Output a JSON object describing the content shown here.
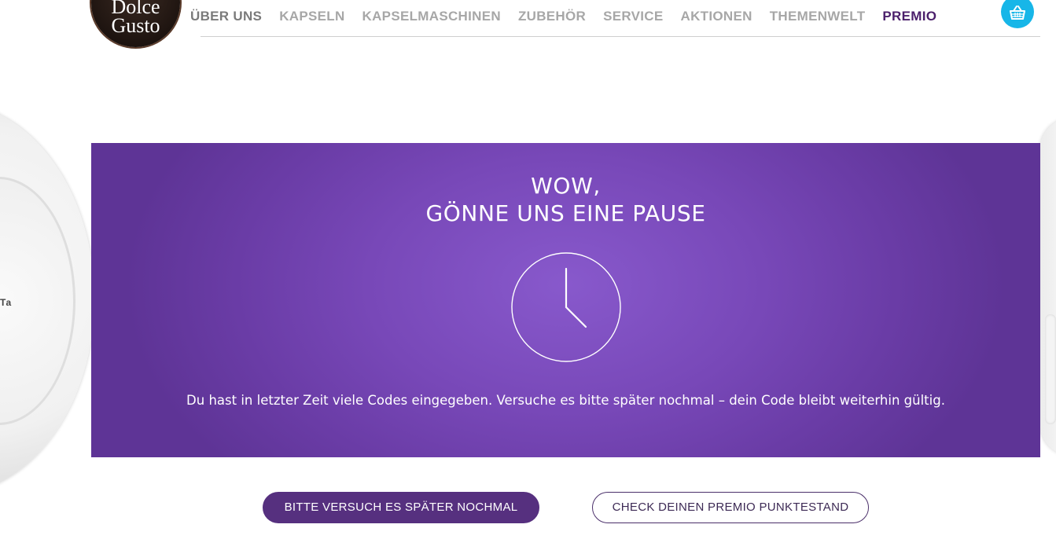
{
  "brand": {
    "logo_line1": "Dolce",
    "logo_line2": "Gusto"
  },
  "nav": {
    "items": [
      {
        "label": "ÜBER UNS"
      },
      {
        "label": "KAPSELN"
      },
      {
        "label": "KAPSELMASCHINEN"
      },
      {
        "label": "ZUBEHÖR"
      },
      {
        "label": "SERVICE"
      },
      {
        "label": "AKTIONEN"
      },
      {
        "label": "THEMENWELT"
      },
      {
        "label": "PREMIO"
      }
    ],
    "cart_icon": "basket-icon"
  },
  "panel": {
    "title_line1": "WOW,",
    "title_line2": "GÖNNE UNS EINE PAUSE",
    "icon": "clock-icon",
    "message": "Du hast in letzter Zeit viele Codes eingegeben. Versuche es bitte später nochmal – dein Code bleibt weiterhin gültig."
  },
  "buttons": {
    "retry_label": "BITTE VERSUCH ES SPÄTER NOCHMAL",
    "check_label": "CHECK DEINEN PREMIO PUNKTESTAND"
  },
  "colors": {
    "panel_purple": "#7848b8",
    "primary_button": "#56307f",
    "premio_nav": "#4b1f6b",
    "cart_blue": "#17b6e8",
    "nav_grey": "#a7a7a7"
  }
}
